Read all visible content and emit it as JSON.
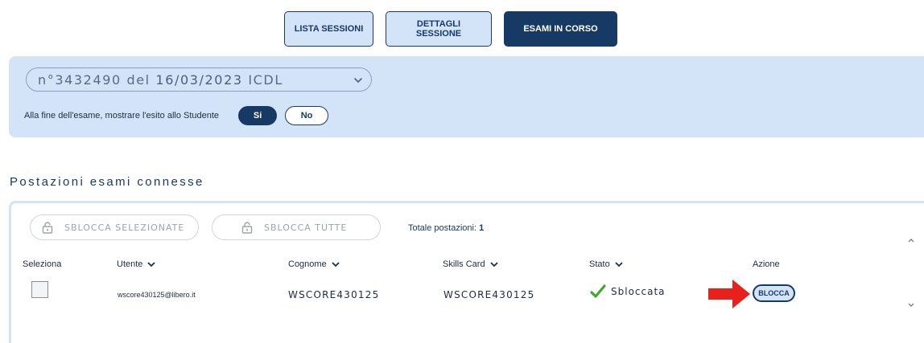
{
  "tabs": [
    {
      "label": "LISTA SESSIONI"
    },
    {
      "label": "DETTAGLI SESSIONE"
    },
    {
      "label": "ESAMI IN CORSO"
    }
  ],
  "session": {
    "prefix": "n°3432490 del ",
    "date": "16/03/2023",
    "suffix": " ICDL",
    "outcome_label": "Alla fine dell'esame, mostrare l'esito allo Studente",
    "yes_label": "Si",
    "no_label": "No"
  },
  "section_title": "Postazioni esami connesse",
  "toolbar": {
    "unlock_selected": "SBLOCCA SELEZIONATE",
    "unlock_all": "SBLOCCA TUTTE",
    "total_label": "Totale postazioni: ",
    "total_value": "1"
  },
  "table": {
    "headers": {
      "select": "Seleziona",
      "user": "Utente",
      "surname": "Cognome",
      "skills_card": "Skills Card",
      "status": "Stato",
      "action": "Azione"
    },
    "rows": [
      {
        "user": "wscore430125@libero.it",
        "surname": "WSCORE430125",
        "skills_card": "WSCORE430125",
        "status": "Sbloccata",
        "action": "BLOCCA"
      }
    ]
  },
  "colors": {
    "primary": "#173a65",
    "panel": "#d3e4f9",
    "status_ok": "#3caa2e",
    "arrow": "#e8211c"
  }
}
